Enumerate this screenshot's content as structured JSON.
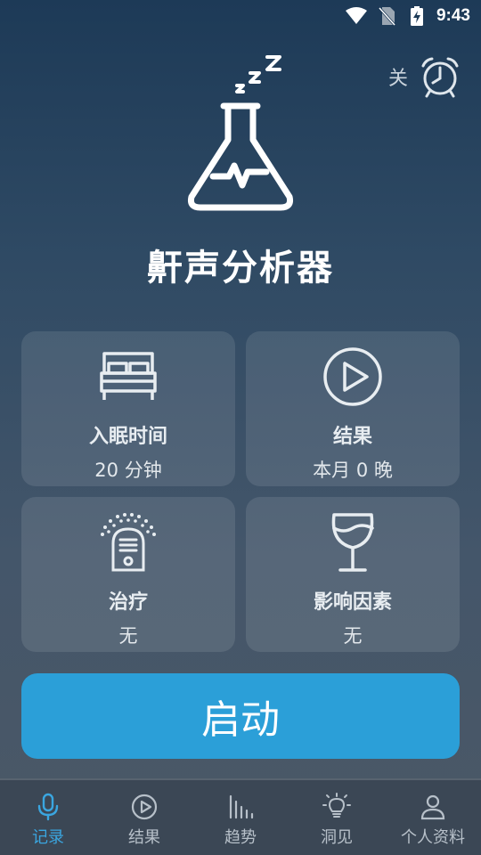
{
  "status_bar": {
    "time": "9:43"
  },
  "alarm": {
    "state_label": "关"
  },
  "app": {
    "title": "鼾声分析器"
  },
  "cards": {
    "sleep": {
      "title": "入眠时间",
      "value": "20 分钟",
      "icon": "bed-icon"
    },
    "results": {
      "title": "结果",
      "value": "本月 0 晚",
      "icon": "play-circle-icon"
    },
    "therapy": {
      "title": "治疗",
      "value": "无",
      "icon": "humidifier-icon"
    },
    "factors": {
      "title": "影响因素",
      "value": "无",
      "icon": "wine-glass-icon"
    }
  },
  "start_button": {
    "label": "启动"
  },
  "nav": {
    "items": [
      {
        "label": "记录",
        "icon": "microphone-icon",
        "active": true
      },
      {
        "label": "结果",
        "icon": "play-circle-icon"
      },
      {
        "label": "趋势",
        "icon": "bar-chart-icon"
      },
      {
        "label": "洞见",
        "icon": "lightbulb-icon"
      },
      {
        "label": "个人资料",
        "icon": "person-icon"
      }
    ]
  },
  "colors": {
    "accent": "#2b9fd8",
    "nav_active": "#3aa6e0",
    "nav_inactive": "#b7c0c9"
  }
}
